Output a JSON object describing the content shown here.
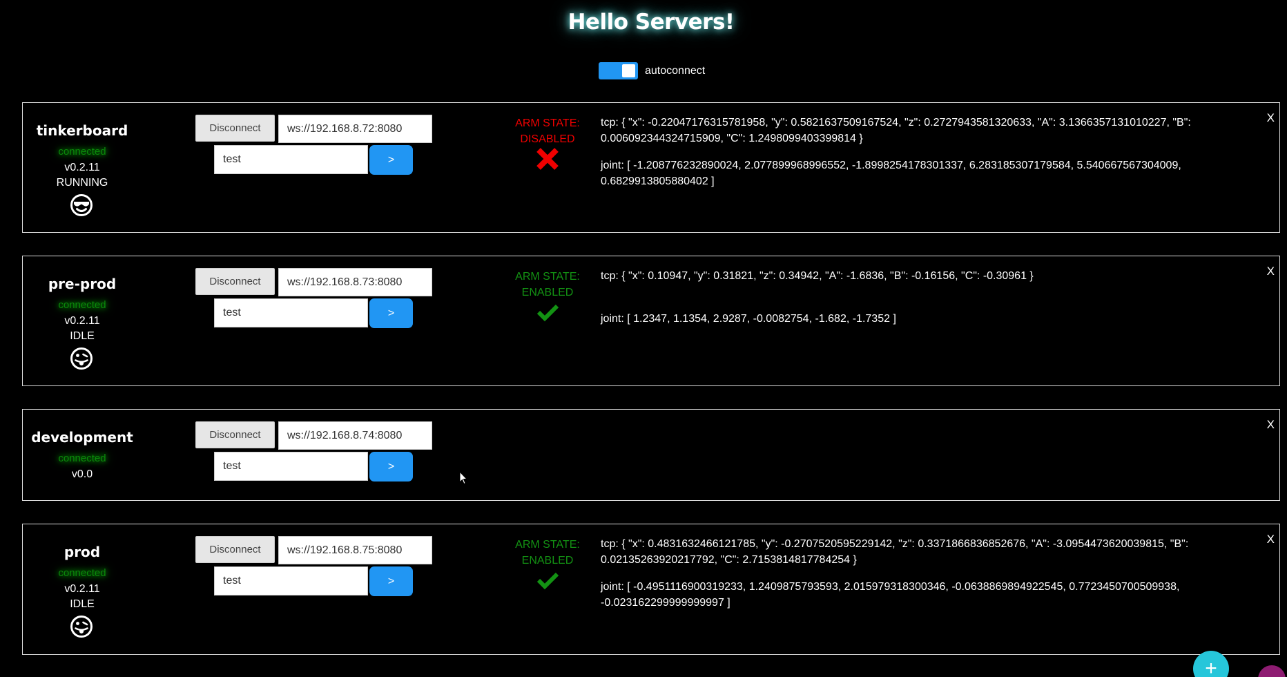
{
  "header": {
    "title": "Hello Servers!",
    "autoconnect_label": "autoconnect",
    "autoconnect_on": true
  },
  "colors": {
    "accent": "#2196f3",
    "connected": "#0a8a0a",
    "disabled": "#f00000",
    "enabled": "#139213",
    "fab": "#26c6da"
  },
  "servers": [
    {
      "name": "tinkerboard",
      "status": "connected",
      "version": "v0.2.11",
      "state": "RUNNING",
      "state_icon": "sunglasses-face-icon",
      "disconnect_label": "Disconnect",
      "ws_url": "ws://192.168.8.72:8080",
      "message": "test",
      "send_label": ">",
      "arm_state_label": "ARM STATE:",
      "arm_state": "DISABLED",
      "arm_icon": "cross-icon",
      "tcp": "tcp: { \"x\": -0.22047176315781958, \"y\": 0.5821637509167524, \"z\": 0.2727943581320633, \"A\": 3.1366357131010227, \"B\": 0.006092344324715909, \"C\": 1.2498099403399814 }",
      "joint": "joint: [ -1.208776232890024, 2.077899968996552, -1.8998254178301337, 6.283185307179584, 5.540667567304009, 0.6829913805880402 ]",
      "close_label": "X"
    },
    {
      "name": "pre-prod",
      "status": "connected",
      "version": "v0.2.11",
      "state": "IDLE",
      "state_icon": "tongue-face-icon",
      "disconnect_label": "Disconnect",
      "ws_url": "ws://192.168.8.73:8080",
      "message": "test",
      "send_label": ">",
      "arm_state_label": "ARM STATE:",
      "arm_state": "ENABLED",
      "arm_icon": "checkmark-icon",
      "tcp": "tcp: { \"x\": 0.10947, \"y\": 0.31821, \"z\": 0.34942, \"A\": -1.6836, \"B\": -0.16156, \"C\": -0.30961 }",
      "joint": "joint: [ 1.2347, 1.1354, 2.9287, -0.0082754, -1.682, -1.7352 ]",
      "close_label": "X"
    },
    {
      "name": "development",
      "status": "connected",
      "version": "v0.0",
      "disconnect_label": "Disconnect",
      "ws_url": "ws://192.168.8.74:8080",
      "message": "test",
      "send_label": ">",
      "close_label": "X"
    },
    {
      "name": "prod",
      "status": "connected",
      "version": "v0.2.11",
      "state": "IDLE",
      "state_icon": "tongue-face-icon",
      "disconnect_label": "Disconnect",
      "ws_url": "ws://192.168.8.75:8080",
      "message": "test",
      "send_label": ">",
      "arm_state_label": "ARM STATE:",
      "arm_state": "ENABLED",
      "arm_icon": "checkmark-icon",
      "tcp": "tcp: { \"x\": 0.4831632466121785, \"y\": -0.2707520595229142, \"z\": 0.3371866836852676, \"A\": -3.0954473620039815, \"B\": 0.02135263920217792, \"C\": 2.7153814817784254 }",
      "joint": "joint: [ -0.4951116900319233, 1.2409875793593, 2.015979318300346, -0.0638869894922545, 0.7723450700509938, -0.023162299999999997 ]",
      "close_label": "X"
    }
  ],
  "fab": {
    "add_label": "+"
  }
}
